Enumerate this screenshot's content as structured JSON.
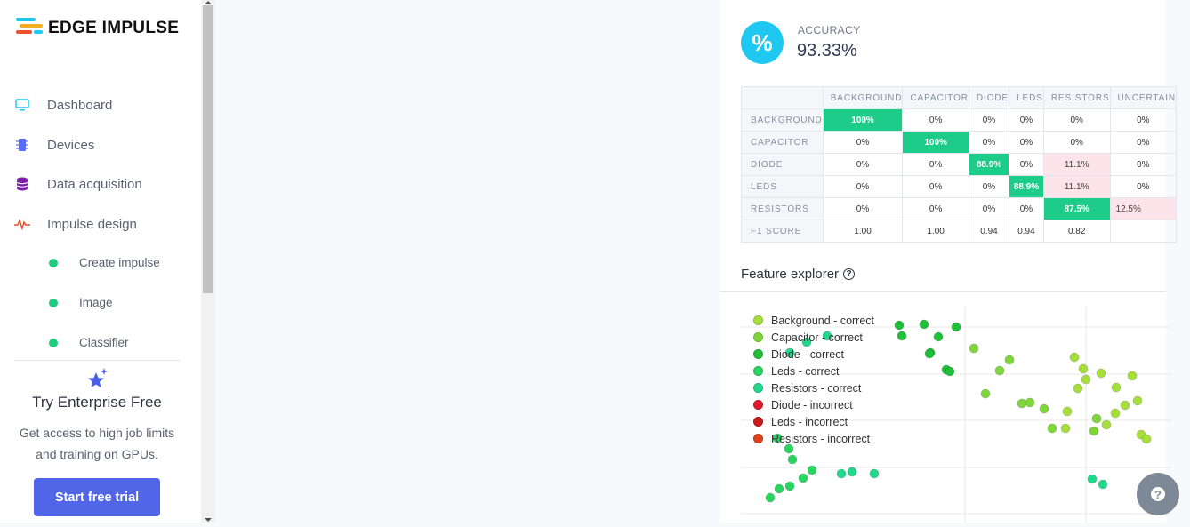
{
  "brand": {
    "name": "EDGE IMPULSE"
  },
  "nav": {
    "items": [
      {
        "label": "Dashboard",
        "icon": "monitor-icon"
      },
      {
        "label": "Devices",
        "icon": "chip-icon"
      },
      {
        "label": "Data acquisition",
        "icon": "database-icon"
      },
      {
        "label": "Impulse design",
        "icon": "pulse-icon"
      }
    ],
    "sub_items": [
      {
        "label": "Create impulse"
      },
      {
        "label": "Image"
      },
      {
        "label": "Classifier"
      }
    ]
  },
  "enterprise": {
    "title": "Try Enterprise Free",
    "line1": "Get access to high job limits",
    "line2": "and training on GPUs.",
    "button": "Start free trial",
    "icon": "sparkle-star-icon"
  },
  "accuracy": {
    "symbol": "%",
    "label": "ACCURACY",
    "value": "93.33%"
  },
  "confusion": {
    "columns": [
      "BACKGROUND",
      "CAPACITOR",
      "DIODE",
      "LEDS",
      "RESISTORS",
      "UNCERTAIN"
    ],
    "rows": [
      {
        "label": "BACKGROUND",
        "cells": [
          "100%",
          "0%",
          "0%",
          "0%",
          "0%",
          "0%"
        ]
      },
      {
        "label": "CAPACITOR",
        "cells": [
          "0%",
          "100%",
          "0%",
          "0%",
          "0%",
          "0%"
        ]
      },
      {
        "label": "DIODE",
        "cells": [
          "0%",
          "0%",
          "88.9%",
          "0%",
          "11.1%",
          "0%"
        ]
      },
      {
        "label": "LEDS",
        "cells": [
          "0%",
          "0%",
          "0%",
          "88.9%",
          "11.1%",
          "0%"
        ]
      },
      {
        "label": "RESISTORS",
        "cells": [
          "0%",
          "0%",
          "0%",
          "0%",
          "87.5%",
          "12.5%"
        ]
      }
    ],
    "f1": {
      "label": "F1 SCORE",
      "cells": [
        "1.00",
        "1.00",
        "0.94",
        "0.94",
        "0.82",
        ""
      ]
    },
    "colors": {
      "correct": "#1ecc8a",
      "error": "#fde3ea"
    }
  },
  "feature_explorer": {
    "title": "Feature explorer",
    "legend": [
      {
        "label": "Background - correct",
        "color": "#a6df3a"
      },
      {
        "label": "Capacitor - correct",
        "color": "#7fd63a"
      },
      {
        "label": "Diode - correct",
        "color": "#1fbf3a"
      },
      {
        "label": "Leds - correct",
        "color": "#2ad460"
      },
      {
        "label": "Resistors - correct",
        "color": "#22d88c"
      },
      {
        "label": "Diode - incorrect",
        "color": "#e3182d"
      },
      {
        "label": "Leds - incorrect",
        "color": "#cc1a1a"
      },
      {
        "label": "Resistors - incorrect",
        "color": "#e0401a"
      }
    ]
  },
  "chart_data": {
    "type": "scatter",
    "title": "",
    "xlabel": "",
    "ylabel": "",
    "grid": true,
    "legend_placement": "top-left",
    "x_range": [
      0,
      484
    ],
    "y_range": [
      0,
      243
    ],
    "series": [
      {
        "name": "Background - correct",
        "x": [
          375,
          385,
          405,
          422,
          440,
          446,
          432,
          421,
          411,
          450,
          456,
          388,
          379,
          367,
          365
        ],
        "y": [
          57,
          70,
          75,
          91,
          78,
          106,
          111,
          120,
          133,
          144,
          149,
          82,
          92,
          118,
          137
        ]
      },
      {
        "name": "Capacitor - correct",
        "x": [
          262,
          302,
          291,
          275,
          316,
          341,
          350,
          325,
          397,
          400
        ],
        "y": [
          47,
          60,
          72,
          98,
          109,
          115,
          137,
          108,
          140,
          126
        ]
      },
      {
        "name": "Diode - correct",
        "x": [
          178,
          206,
          181,
          222,
          213,
          242,
          212,
          231,
          235
        ],
        "y": [
          21,
          20,
          33,
          34,
          52,
          23,
          53,
          71,
          73
        ]
      },
      {
        "name": "Leds - correct",
        "x": [
          33,
          43,
          55,
          70,
          80,
          58,
          41,
          54
        ],
        "y": [
          215,
          205,
          202,
          193,
          184,
          172,
          148,
          160
        ]
      },
      {
        "name": "Resistors - correct",
        "x": [
          55,
          74,
          97,
          113,
          125,
          150,
          407,
          395
        ],
        "y": [
          52,
          40,
          33,
          188,
          186,
          188,
          200,
          194
        ]
      },
      {
        "name": "Diode - incorrect",
        "x": [],
        "y": []
      },
      {
        "name": "Leds - incorrect",
        "x": [],
        "y": []
      },
      {
        "name": "Resistors - incorrect",
        "x": [],
        "y": []
      }
    ]
  },
  "help_fab": {
    "label": "?"
  }
}
